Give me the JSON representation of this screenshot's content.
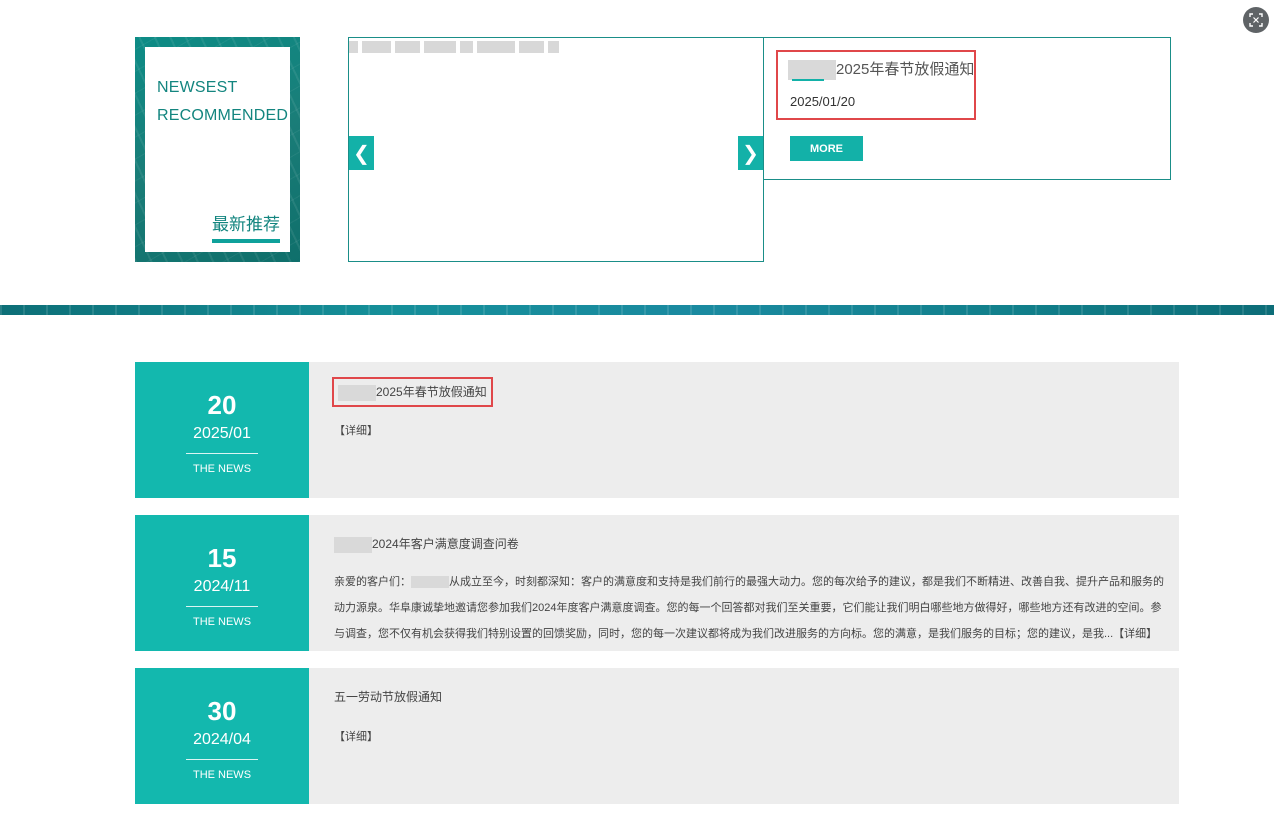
{
  "recommended": {
    "en_line1": "NEWSEST",
    "en_line2": "RECOMMENDED",
    "zh_label": "最新推荐"
  },
  "carousel": {
    "prev_arrow": "❮",
    "next_arrow": "❯"
  },
  "feature": {
    "title": "2025年春节放假通知",
    "date": "2025/01/20",
    "more_label": "MORE"
  },
  "news": [
    {
      "day": "20",
      "year_month": "2025/01",
      "tag": "THE NEWS",
      "title": "2025年春节放假通知",
      "detail": "【详细】"
    },
    {
      "day": "15",
      "year_month": "2024/11",
      "tag": "THE NEWS",
      "title": "2024年客户满意度调查问卷",
      "desc_prefix": "亲爱的客户们：",
      "desc_body": "从成立至今，时刻都深知：客户的满意度和支持是我们前行的最强大动力。您的每次给予的建议，都是我们不断精进、改善自我、提升产品和服务的动力源泉。华阜康诚挚地邀请您参加我们2024年度客户满意度调查。您的每一个回答都对我们至关重要，它们能让我们明白哪些地方做得好，哪些地方还有改进的空间。参与调查，您不仅有机会获得我们特别设置的回馈奖励，同时，您的每一次建议都将成为我们改进服务的方向标。您的满意，是我们服务的目标；您的建议，是我...【详细】"
    },
    {
      "day": "30",
      "year_month": "2024/04",
      "tag": "THE NEWS",
      "title": "五一劳动节放假通知",
      "detail": "【详细】"
    }
  ]
}
